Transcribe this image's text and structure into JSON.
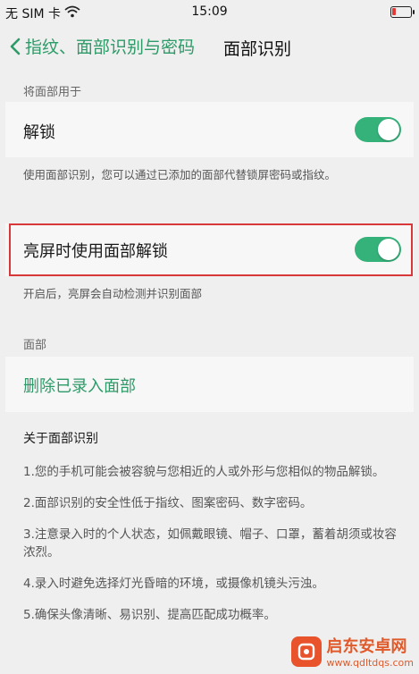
{
  "status_bar": {
    "carrier": "无 SIM 卡",
    "time": "15:09"
  },
  "header": {
    "back_label": "指纹、面部识别与密码",
    "title": "面部识别"
  },
  "section_use": {
    "label": "将面部用于",
    "unlock_label": "解锁",
    "unlock_hint": "使用面部识别，您可以通过已添加的面部代替锁屏密码或指纹。",
    "screen_on_label": "亮屏时使用面部解锁",
    "screen_on_hint": "开启后，亮屏会自动检测并识别面部"
  },
  "section_face": {
    "label": "面部",
    "delete_label": "删除已录入面部"
  },
  "about": {
    "title": "关于面部识别",
    "items": [
      "1.您的手机可能会被容貌与您相近的人或外形与您相似的物品解锁。",
      "2.面部识别的安全性低于指纹、图案密码、数字密码。",
      "3.注意录入时的个人状态，如佩戴眼镜、帽子、口罩，蓄着胡须或妆容浓烈。",
      "4.录入时避免选择灯光昏暗的环境，或摄像机镜头污浊。",
      "5.确保头像清晰、易识别、提高匹配成功概率。"
    ]
  },
  "watermark": {
    "name": "启东安卓网",
    "url": "www.qdltdqs.com"
  },
  "colors": {
    "accent": "#35b27a",
    "link": "#2d9a67",
    "highlight_border": "#d9383a"
  },
  "icons": [
    "wifi-icon",
    "battery-icon",
    "back-chevron-icon",
    "watermark-logo-icon"
  ]
}
